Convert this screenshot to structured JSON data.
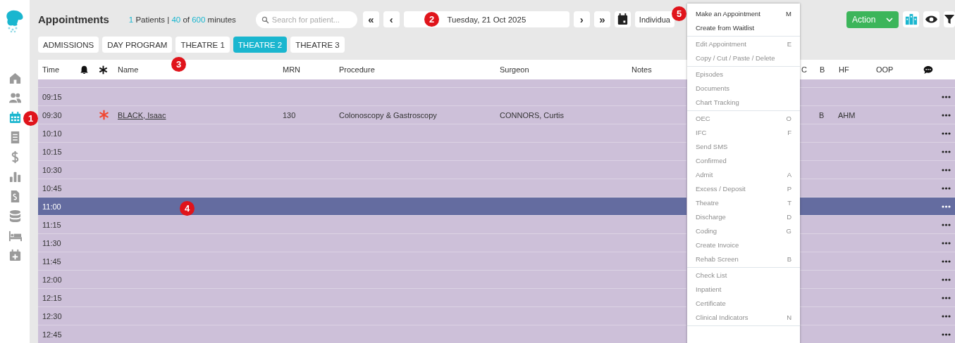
{
  "sidebar": {
    "items": [
      {
        "selected": false
      },
      {
        "selected": false
      },
      {
        "selected": true
      },
      {
        "selected": false
      },
      {
        "selected": false
      },
      {
        "selected": false
      },
      {
        "selected": false
      },
      {
        "selected": false
      },
      {
        "selected": false
      },
      {
        "selected": false
      }
    ]
  },
  "header": {
    "title": "Appointments",
    "stats": [
      {
        "text": "1",
        "accent": true
      },
      {
        "text": "Patients |",
        "accent": false
      },
      {
        "text": "40",
        "accent": true
      },
      {
        "text": "of",
        "accent": false
      },
      {
        "text": "600",
        "accent": true
      },
      {
        "text": "minutes",
        "accent": false
      }
    ],
    "search": {
      "placeholder": "Search for patient..."
    },
    "nav": {
      "first": "«",
      "prev": "‹",
      "date": "Tuesday, 21 Oct 2025",
      "next": "›",
      "last": "»"
    },
    "view": "Individua",
    "action": "Action"
  },
  "tabs": [
    {
      "label": "ADMISSIONS",
      "selected": false
    },
    {
      "label": "DAY PROGRAM",
      "selected": false
    },
    {
      "label": "THEATRE 1",
      "selected": false
    },
    {
      "label": "THEATRE 2",
      "selected": true
    },
    {
      "label": "THEATRE 3",
      "selected": false
    }
  ],
  "table": {
    "columns": [
      {
        "kind": "text",
        "label": "Time"
      },
      {
        "kind": "bell"
      },
      {
        "kind": "asterisk"
      },
      {
        "kind": "text",
        "label": "Name"
      },
      {
        "kind": "text",
        "label": "MRN"
      },
      {
        "kind": "text",
        "label": "Procedure"
      },
      {
        "kind": "text",
        "label": "Surgeon"
      },
      {
        "kind": "text",
        "label": "Notes"
      },
      {
        "kind": "text",
        "label": "C"
      },
      {
        "kind": "text",
        "label": "B"
      },
      {
        "kind": "text",
        "label": "HF"
      },
      {
        "kind": "text",
        "label": "OOP"
      },
      {
        "kind": "comment"
      }
    ],
    "rows": [
      {
        "time": "09:15",
        "urgent": false,
        "selected": false
      },
      {
        "time": "09:30",
        "urgent": true,
        "name": "BLACK, Isaac",
        "mrn": "130",
        "procedure": "Colonoscopy & Gastroscopy",
        "surgeon": "CONNORS, Curtis",
        "b": "B",
        "hf": "AHM",
        "selected": false
      },
      {
        "time": "10:10",
        "urgent": false,
        "selected": false
      },
      {
        "time": "10:15",
        "urgent": false,
        "selected": false
      },
      {
        "time": "10:30",
        "urgent": false,
        "selected": false
      },
      {
        "time": "10:45",
        "urgent": false,
        "selected": false
      },
      {
        "time": "11:00",
        "urgent": false,
        "selected": true
      },
      {
        "time": "11:15",
        "urgent": false,
        "selected": false
      },
      {
        "time": "11:30",
        "urgent": false,
        "selected": false
      },
      {
        "time": "11:45",
        "urgent": false,
        "selected": false
      },
      {
        "time": "12:00",
        "urgent": false,
        "selected": false
      },
      {
        "time": "12:15",
        "urgent": false,
        "selected": false
      },
      {
        "time": "12:30",
        "urgent": false,
        "selected": false
      },
      {
        "time": "12:45",
        "urgent": false,
        "selected": false
      }
    ]
  },
  "context_menu": {
    "groups": [
      [
        {
          "label": "Make an Appointment",
          "shortcut": "M",
          "disabled": false
        },
        {
          "label": "Create from Waitlist",
          "disabled": false
        }
      ],
      [
        {
          "label": "Edit Appointment",
          "shortcut": "E",
          "disabled": true
        },
        {
          "label": "Copy / Cut / Paste / Delete",
          "disabled": true
        }
      ],
      [
        {
          "label": "Episodes",
          "disabled": true
        },
        {
          "label": "Documents",
          "disabled": true
        },
        {
          "label": "Chart Tracking",
          "disabled": true
        }
      ],
      [
        {
          "label": "OEC",
          "shortcut": "O",
          "disabled": true
        },
        {
          "label": "IFC",
          "shortcut": "F",
          "disabled": true
        },
        {
          "label": "Send SMS",
          "disabled": true
        },
        {
          "label": "Confirmed",
          "disabled": true
        },
        {
          "label": "Admit",
          "shortcut": "A",
          "disabled": true
        },
        {
          "label": "Excess / Deposit",
          "shortcut": "P",
          "disabled": true
        },
        {
          "label": "Theatre",
          "shortcut": "T",
          "disabled": true
        },
        {
          "label": "Discharge",
          "shortcut": "D",
          "disabled": true
        },
        {
          "label": "Coding",
          "shortcut": "G",
          "disabled": true
        },
        {
          "label": "Create Invoice",
          "disabled": true
        },
        {
          "label": "Rehab Screen",
          "shortcut": "B",
          "disabled": true
        }
      ],
      [
        {
          "label": "Check List",
          "disabled": true
        },
        {
          "label": "Inpatient",
          "disabled": true
        },
        {
          "label": "Certificate",
          "disabled": true
        },
        {
          "label": "Clinical Indicators",
          "shortcut": "N",
          "disabled": true
        }
      ]
    ]
  },
  "markers": [
    {
      "label": "1"
    },
    {
      "label": "2"
    },
    {
      "label": "3"
    },
    {
      "label": "4"
    },
    {
      "label": "5"
    }
  ]
}
